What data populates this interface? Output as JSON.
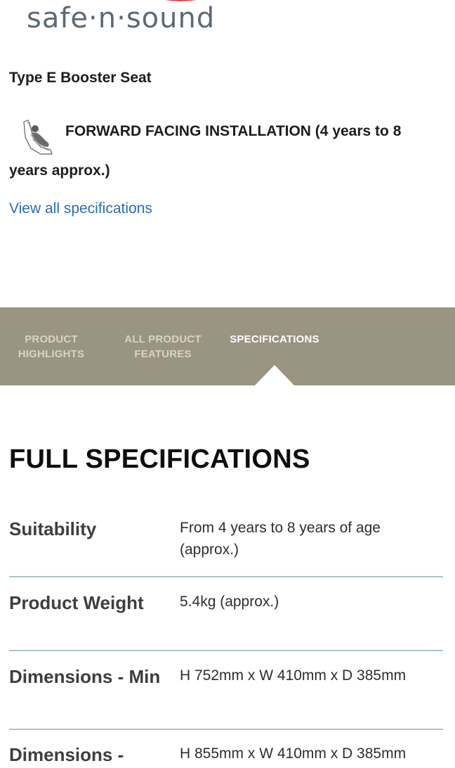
{
  "brand": {
    "name": "safe·n·sound",
    "accent_color": "#d8232a",
    "text_color": "#5d6a76"
  },
  "product": {
    "title": "Type E Booster Seat",
    "installation_icon": "forward-facing-seat-icon",
    "installation_line1": "FORWARD FACING INSTALLATION (4 years to 8",
    "installation_line2": "years approx.)",
    "view_all_link": "View all specifications"
  },
  "tabs": {
    "background": "#9a9482",
    "items": [
      {
        "line1": "PRODUCT",
        "line2": "HIGHLIGHTS",
        "active": false
      },
      {
        "line1": "ALL PRODUCT",
        "line2": "FEATURES",
        "active": false
      },
      {
        "line1": "SPECIFICATIONS",
        "line2": "",
        "active": true
      }
    ]
  },
  "specs": {
    "heading": "FULL SPECIFICATIONS",
    "divider_color": "#a9c4d2",
    "rows": [
      {
        "label": "Suitability",
        "value": "From 4 years to 8 years of age (approx.)"
      },
      {
        "label": "Product Weight",
        "value": "5.4kg (approx.)"
      },
      {
        "label": "Dimensions - Min",
        "value": "H 752mm x W 410mm x D 385mm"
      },
      {
        "label": "Dimensions -",
        "value": "H 855mm x W 410mm x D 385mm"
      }
    ]
  }
}
